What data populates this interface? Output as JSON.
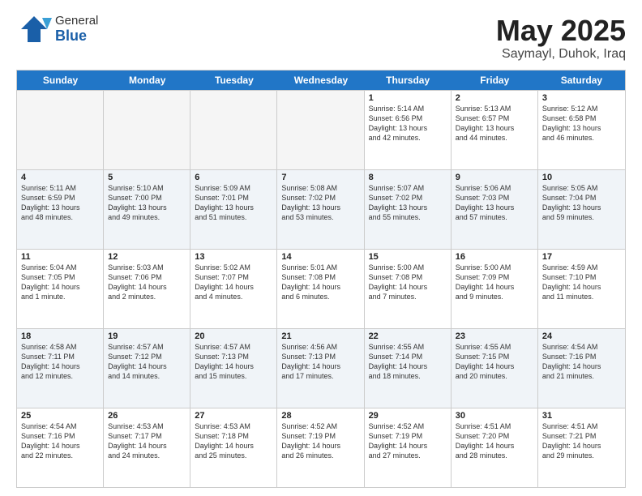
{
  "header": {
    "logo_general": "General",
    "logo_blue": "Blue",
    "month_title": "May 2025",
    "location": "Saymayl, Duhok, Iraq"
  },
  "weekdays": [
    "Sunday",
    "Monday",
    "Tuesday",
    "Wednesday",
    "Thursday",
    "Friday",
    "Saturday"
  ],
  "rows": [
    [
      {
        "day": "",
        "info": "",
        "empty": true
      },
      {
        "day": "",
        "info": "",
        "empty": true
      },
      {
        "day": "",
        "info": "",
        "empty": true
      },
      {
        "day": "",
        "info": "",
        "empty": true
      },
      {
        "day": "1",
        "info": "Sunrise: 5:14 AM\nSunset: 6:56 PM\nDaylight: 13 hours\nand 42 minutes.",
        "empty": false
      },
      {
        "day": "2",
        "info": "Sunrise: 5:13 AM\nSunset: 6:57 PM\nDaylight: 13 hours\nand 44 minutes.",
        "empty": false
      },
      {
        "day": "3",
        "info": "Sunrise: 5:12 AM\nSunset: 6:58 PM\nDaylight: 13 hours\nand 46 minutes.",
        "empty": false
      }
    ],
    [
      {
        "day": "4",
        "info": "Sunrise: 5:11 AM\nSunset: 6:59 PM\nDaylight: 13 hours\nand 48 minutes.",
        "empty": false
      },
      {
        "day": "5",
        "info": "Sunrise: 5:10 AM\nSunset: 7:00 PM\nDaylight: 13 hours\nand 49 minutes.",
        "empty": false
      },
      {
        "day": "6",
        "info": "Sunrise: 5:09 AM\nSunset: 7:01 PM\nDaylight: 13 hours\nand 51 minutes.",
        "empty": false
      },
      {
        "day": "7",
        "info": "Sunrise: 5:08 AM\nSunset: 7:02 PM\nDaylight: 13 hours\nand 53 minutes.",
        "empty": false
      },
      {
        "day": "8",
        "info": "Sunrise: 5:07 AM\nSunset: 7:02 PM\nDaylight: 13 hours\nand 55 minutes.",
        "empty": false
      },
      {
        "day": "9",
        "info": "Sunrise: 5:06 AM\nSunset: 7:03 PM\nDaylight: 13 hours\nand 57 minutes.",
        "empty": false
      },
      {
        "day": "10",
        "info": "Sunrise: 5:05 AM\nSunset: 7:04 PM\nDaylight: 13 hours\nand 59 minutes.",
        "empty": false
      }
    ],
    [
      {
        "day": "11",
        "info": "Sunrise: 5:04 AM\nSunset: 7:05 PM\nDaylight: 14 hours\nand 1 minute.",
        "empty": false
      },
      {
        "day": "12",
        "info": "Sunrise: 5:03 AM\nSunset: 7:06 PM\nDaylight: 14 hours\nand 2 minutes.",
        "empty": false
      },
      {
        "day": "13",
        "info": "Sunrise: 5:02 AM\nSunset: 7:07 PM\nDaylight: 14 hours\nand 4 minutes.",
        "empty": false
      },
      {
        "day": "14",
        "info": "Sunrise: 5:01 AM\nSunset: 7:08 PM\nDaylight: 14 hours\nand 6 minutes.",
        "empty": false
      },
      {
        "day": "15",
        "info": "Sunrise: 5:00 AM\nSunset: 7:08 PM\nDaylight: 14 hours\nand 7 minutes.",
        "empty": false
      },
      {
        "day": "16",
        "info": "Sunrise: 5:00 AM\nSunset: 7:09 PM\nDaylight: 14 hours\nand 9 minutes.",
        "empty": false
      },
      {
        "day": "17",
        "info": "Sunrise: 4:59 AM\nSunset: 7:10 PM\nDaylight: 14 hours\nand 11 minutes.",
        "empty": false
      }
    ],
    [
      {
        "day": "18",
        "info": "Sunrise: 4:58 AM\nSunset: 7:11 PM\nDaylight: 14 hours\nand 12 minutes.",
        "empty": false
      },
      {
        "day": "19",
        "info": "Sunrise: 4:57 AM\nSunset: 7:12 PM\nDaylight: 14 hours\nand 14 minutes.",
        "empty": false
      },
      {
        "day": "20",
        "info": "Sunrise: 4:57 AM\nSunset: 7:13 PM\nDaylight: 14 hours\nand 15 minutes.",
        "empty": false
      },
      {
        "day": "21",
        "info": "Sunrise: 4:56 AM\nSunset: 7:13 PM\nDaylight: 14 hours\nand 17 minutes.",
        "empty": false
      },
      {
        "day": "22",
        "info": "Sunrise: 4:55 AM\nSunset: 7:14 PM\nDaylight: 14 hours\nand 18 minutes.",
        "empty": false
      },
      {
        "day": "23",
        "info": "Sunrise: 4:55 AM\nSunset: 7:15 PM\nDaylight: 14 hours\nand 20 minutes.",
        "empty": false
      },
      {
        "day": "24",
        "info": "Sunrise: 4:54 AM\nSunset: 7:16 PM\nDaylight: 14 hours\nand 21 minutes.",
        "empty": false
      }
    ],
    [
      {
        "day": "25",
        "info": "Sunrise: 4:54 AM\nSunset: 7:16 PM\nDaylight: 14 hours\nand 22 minutes.",
        "empty": false
      },
      {
        "day": "26",
        "info": "Sunrise: 4:53 AM\nSunset: 7:17 PM\nDaylight: 14 hours\nand 24 minutes.",
        "empty": false
      },
      {
        "day": "27",
        "info": "Sunrise: 4:53 AM\nSunset: 7:18 PM\nDaylight: 14 hours\nand 25 minutes.",
        "empty": false
      },
      {
        "day": "28",
        "info": "Sunrise: 4:52 AM\nSunset: 7:19 PM\nDaylight: 14 hours\nand 26 minutes.",
        "empty": false
      },
      {
        "day": "29",
        "info": "Sunrise: 4:52 AM\nSunset: 7:19 PM\nDaylight: 14 hours\nand 27 minutes.",
        "empty": false
      },
      {
        "day": "30",
        "info": "Sunrise: 4:51 AM\nSunset: 7:20 PM\nDaylight: 14 hours\nand 28 minutes.",
        "empty": false
      },
      {
        "day": "31",
        "info": "Sunrise: 4:51 AM\nSunset: 7:21 PM\nDaylight: 14 hours\nand 29 minutes.",
        "empty": false
      }
    ]
  ]
}
